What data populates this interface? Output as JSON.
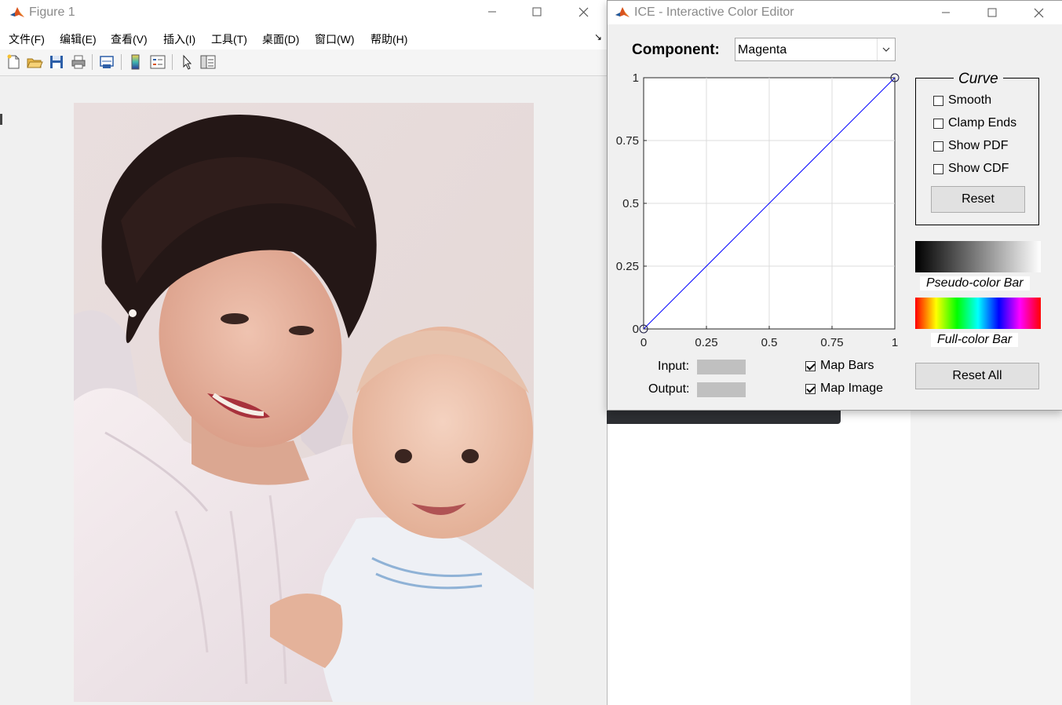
{
  "figure_window": {
    "title": "Figure 1",
    "menu": [
      "文件(F)",
      "编辑(E)",
      "查看(V)",
      "插入(I)",
      "工具(T)",
      "桌面(D)",
      "窗口(W)",
      "帮助(H)"
    ],
    "toolbar_icons": [
      "new-figure-icon",
      "open-file-icon",
      "save-icon",
      "print-icon",
      "link-plot-icon",
      "colorbar-icon",
      "legend-icon",
      "pointer-icon",
      "property-inspector-icon"
    ],
    "image_content": "photo-mother-and-baby"
  },
  "ice_window": {
    "title": "ICE - Interactive Color Editor",
    "component_label": "Component:",
    "component_value": "Magenta",
    "curve_group": {
      "title": "Curve",
      "options": [
        {
          "label": "Smooth",
          "checked": false
        },
        {
          "label": "Clamp Ends",
          "checked": false
        },
        {
          "label": "Show PDF",
          "checked": false
        },
        {
          "label": "Show CDF",
          "checked": false
        }
      ],
      "reset_label": "Reset"
    },
    "pseudo_bar_caption": "Pseudo-color Bar",
    "full_bar_caption": "Full-color Bar",
    "reset_all_label": "Reset All",
    "input_label": "Input:",
    "output_label": "Output:",
    "map_options": [
      {
        "label": "Map Bars",
        "checked": true
      },
      {
        "label": "Map Image",
        "checked": true
      }
    ],
    "plot": {
      "xlim": [
        0,
        1
      ],
      "ylim": [
        0,
        1
      ],
      "xticks": [
        "0",
        "0.25",
        "0.5",
        "0.75",
        "1"
      ],
      "yticks": [
        "0",
        "0.25",
        "0.5",
        "0.75",
        "1"
      ],
      "grid": true,
      "curve_color": "#0000ff",
      "control_points": [
        [
          0,
          0
        ],
        [
          1,
          1
        ]
      ]
    }
  },
  "colors": {
    "window_bg": "#f0f0f0",
    "curve": "#0000ff",
    "button": "#e1e1e1"
  }
}
